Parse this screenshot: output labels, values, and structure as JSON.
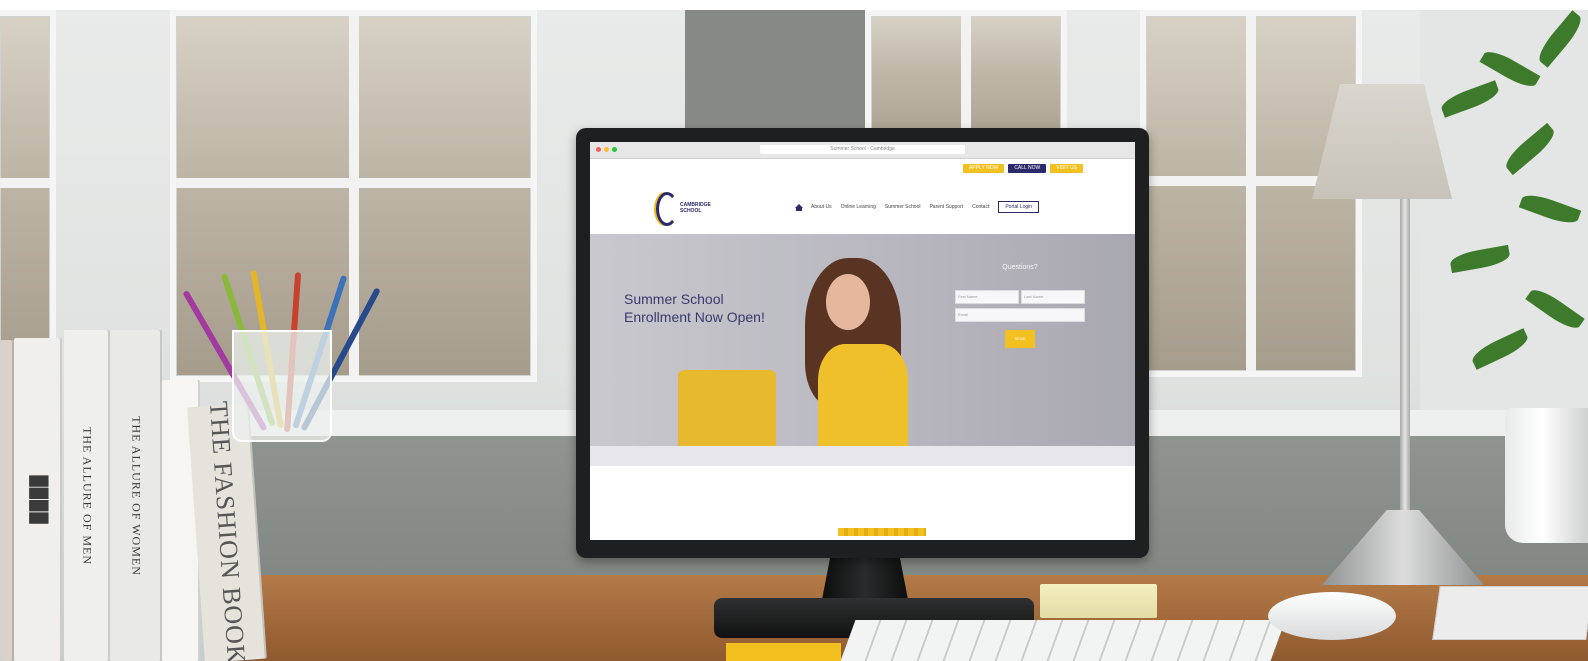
{
  "scene": {
    "description_label": "Desk with monitor showing school website",
    "accent_color": "#f2c01f",
    "brand_color": "#2b2a6b"
  },
  "books": {
    "titles": [
      "THE ALLURE OF MEN",
      "THE ALLURE OF WOMEN",
      "THE FASHION BOOK"
    ]
  },
  "browser": {
    "url": "Summer School - Cambridge"
  },
  "site": {
    "logo_text_line1": "CAMBRIDGE",
    "logo_text_line2": "SCHOOL",
    "top_buttons": [
      {
        "label": "APPLY NOW",
        "color": "#f2c01f"
      },
      {
        "label": "CALL NOW",
        "color": "#2b2a6b"
      },
      {
        "label": "VISIT US",
        "color": "#f2c01f"
      }
    ],
    "nav": [
      "About Us",
      "Online Learning",
      "Summer School",
      "Parent Support",
      "Contact"
    ],
    "portal_login": "Portal Login",
    "hero_title": "Summer School Enrollment Now Open!",
    "form": {
      "title": "Questions?",
      "first_placeholder": "First Name",
      "last_placeholder": "Last Name",
      "email_placeholder": "Email",
      "submit_label": "SEND"
    }
  }
}
